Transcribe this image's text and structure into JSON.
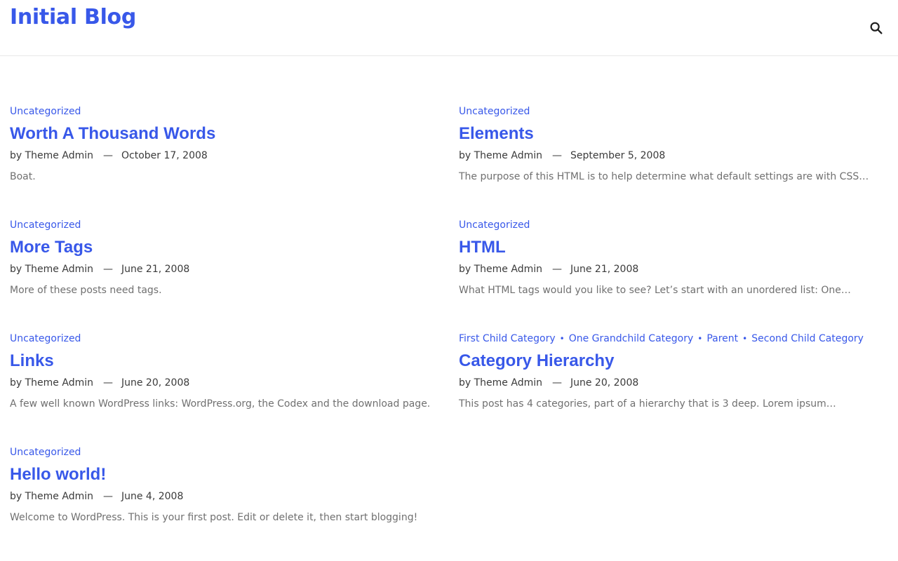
{
  "site": {
    "title": "Initial Blog",
    "accent_color": "#3858e9",
    "search_icon": "search-icon"
  },
  "posts": [
    {
      "categories": [
        "Uncategorized"
      ],
      "title": "Worth A Thousand Words",
      "by": "by",
      "author": "Theme Admin",
      "dash": "—",
      "date": "October 17, 2008",
      "excerpt": "Boat."
    },
    {
      "categories": [
        "Uncategorized"
      ],
      "title": "Elements",
      "by": "by",
      "author": "Theme Admin",
      "dash": "—",
      "date": "September 5, 2008",
      "excerpt": "The purpose of this HTML is to help determine what default settings are with CSS…"
    },
    {
      "categories": [
        "Uncategorized"
      ],
      "title": "More Tags",
      "by": "by",
      "author": "Theme Admin",
      "dash": "—",
      "date": "June 21, 2008",
      "excerpt": "More of these posts need tags."
    },
    {
      "categories": [
        "Uncategorized"
      ],
      "title": "HTML",
      "by": "by",
      "author": "Theme Admin",
      "dash": "—",
      "date": "June 21, 2008",
      "excerpt": "What HTML tags would you like to see? Let’s start with an unordered list: One…"
    },
    {
      "categories": [
        "Uncategorized"
      ],
      "title": "Links",
      "by": "by",
      "author": "Theme Admin",
      "dash": "—",
      "date": "June 20, 2008",
      "excerpt": "A few well known WordPress links: WordPress.org, the Codex and the download page."
    },
    {
      "categories": [
        "First Child Category",
        "One Grandchild Category",
        "Parent",
        "Second Child Category"
      ],
      "title": "Category Hierarchy",
      "by": "by",
      "author": "Theme Admin",
      "dash": "—",
      "date": "June 20, 2008",
      "excerpt": "This post has 4 categories, part of a hierarchy that is 3 deep. Lorem ipsum…"
    },
    {
      "categories": [
        "Uncategorized"
      ],
      "title": "Hello world!",
      "by": "by",
      "author": "Theme Admin",
      "dash": "—",
      "date": "June 4, 2008",
      "excerpt": "Welcome to WordPress. This is your first post. Edit or delete it, then start blogging!"
    }
  ]
}
